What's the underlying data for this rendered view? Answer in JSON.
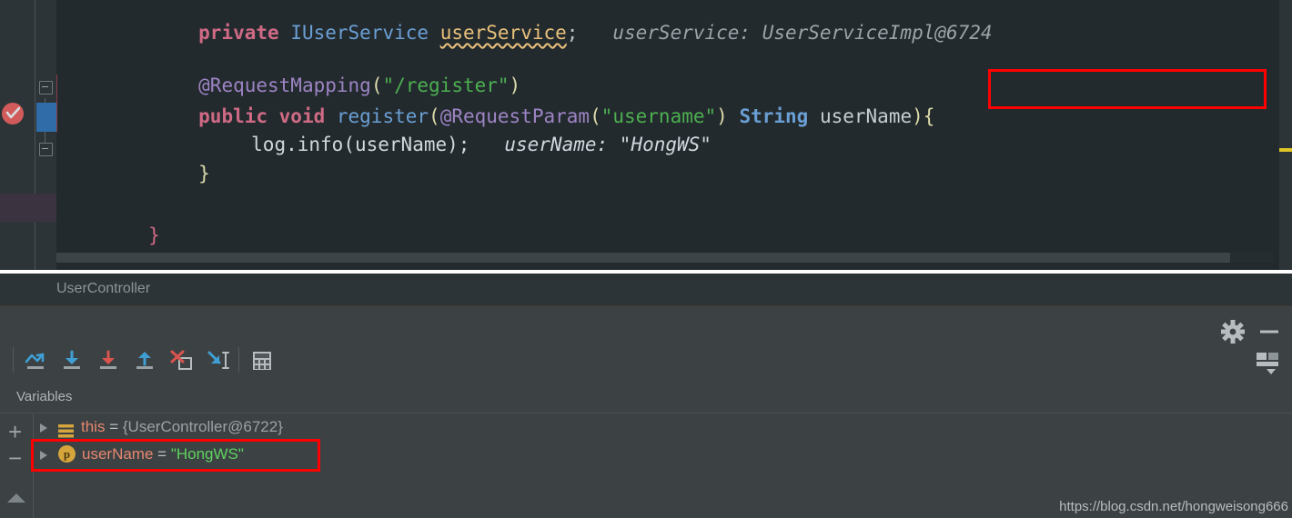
{
  "editor": {
    "lines": [
      {
        "id": "line-field",
        "tokens": [
          {
            "t": "private ",
            "c": "kw"
          },
          {
            "t": "IUserService ",
            "c": "type"
          },
          {
            "t": "userService",
            "c": "field-wavy"
          },
          {
            "t": ";",
            "c": "plain"
          },
          {
            "t": "   userService: UserServiceImpl@6724",
            "c": "hint"
          }
        ]
      },
      {
        "id": "line-annotation",
        "tokens": [
          {
            "t": "@RequestMapping",
            "c": "anno"
          },
          {
            "t": "(",
            "c": "paren"
          },
          {
            "t": "\"/register\"",
            "c": "str"
          },
          {
            "t": ")",
            "c": "paren"
          }
        ]
      },
      {
        "id": "line-signature",
        "tokens": [
          {
            "t": "public void ",
            "c": "kw"
          },
          {
            "t": "register",
            "c": "type"
          },
          {
            "t": "(",
            "c": "paren"
          },
          {
            "t": "@RequestParam",
            "c": "anno"
          },
          {
            "t": "(",
            "c": "paren"
          },
          {
            "t": "\"username\"",
            "c": "str"
          },
          {
            "t": ") ",
            "c": "paren"
          },
          {
            "t": "String ",
            "c": "typeb"
          },
          {
            "t": "userName",
            "c": "ident"
          },
          {
            "t": ")",
            "c": "paren"
          },
          {
            "t": "{",
            "c": "brace"
          }
        ]
      },
      {
        "id": "line-exec",
        "tokens": [
          {
            "t": "log",
            "c": "onexec"
          },
          {
            "t": ".",
            "c": "onexec"
          },
          {
            "t": "info",
            "c": "onexec"
          },
          {
            "t": "(",
            "c": "onexec"
          },
          {
            "t": "userName",
            "c": "onexec"
          },
          {
            "t": ");",
            "c": "onexec"
          },
          {
            "t": "   userName: \"HongWS\"",
            "c": "hint-sel"
          }
        ]
      },
      {
        "id": "line-method-close",
        "tokens": [
          {
            "t": "}",
            "c": "brace"
          }
        ]
      },
      {
        "id": "line-class-close",
        "tokens": [
          {
            "t": "}",
            "c": "brace-red"
          }
        ]
      }
    ],
    "inline_hint_boxed": "userName:  \"HongWS\"",
    "breakpoint_icon": "breakpoint-verified-icon",
    "fold_icons": [
      "fold-collapse-icon",
      "fold-collapse-icon"
    ],
    "marker_color": "#e0c528"
  },
  "tabbar": {
    "active_tab": "UserController"
  },
  "debug": {
    "toolbar": [
      {
        "name": "step-over-button",
        "title": "Step Over"
      },
      {
        "name": "step-into-button",
        "title": "Step Into"
      },
      {
        "name": "force-step-into-button",
        "title": "Force Step Into"
      },
      {
        "name": "step-out-button",
        "title": "Step Out"
      },
      {
        "name": "drop-frame-button",
        "title": "Drop Frame"
      },
      {
        "name": "run-to-cursor-button",
        "title": "Run to Cursor"
      },
      {
        "name": "evaluate-expression-button",
        "title": "Evaluate Expression"
      }
    ],
    "right_icons": [
      {
        "name": "settings-gear-icon",
        "title": "Settings"
      },
      {
        "name": "hide-minimize-icon",
        "title": "Hide"
      },
      {
        "name": "layout-settings-icon",
        "title": "Layout Settings"
      }
    ],
    "panel_title": "Variables",
    "side_buttons": {
      "add": "+",
      "remove": "−"
    },
    "variables": [
      {
        "icon": "object-node-icon",
        "name": "this",
        "equals": "=",
        "value": "{UserController@6722}",
        "value_kind": "object",
        "highlighted": false
      },
      {
        "icon": "parameter-p-icon",
        "name": "userName",
        "equals": "=",
        "value": "\"HongWS\"",
        "value_kind": "string",
        "highlighted": true
      }
    ]
  },
  "watermark": {
    "text": "https://blog.csdn.net/hongweisong666"
  },
  "colors": {
    "editor_bg": "#232a2e",
    "exec_line": "#3171ad",
    "panel_bg": "#3c4143",
    "highlight_box": "#ff0000",
    "string_green": "#5fd35f",
    "var_name": "#e6876f"
  }
}
